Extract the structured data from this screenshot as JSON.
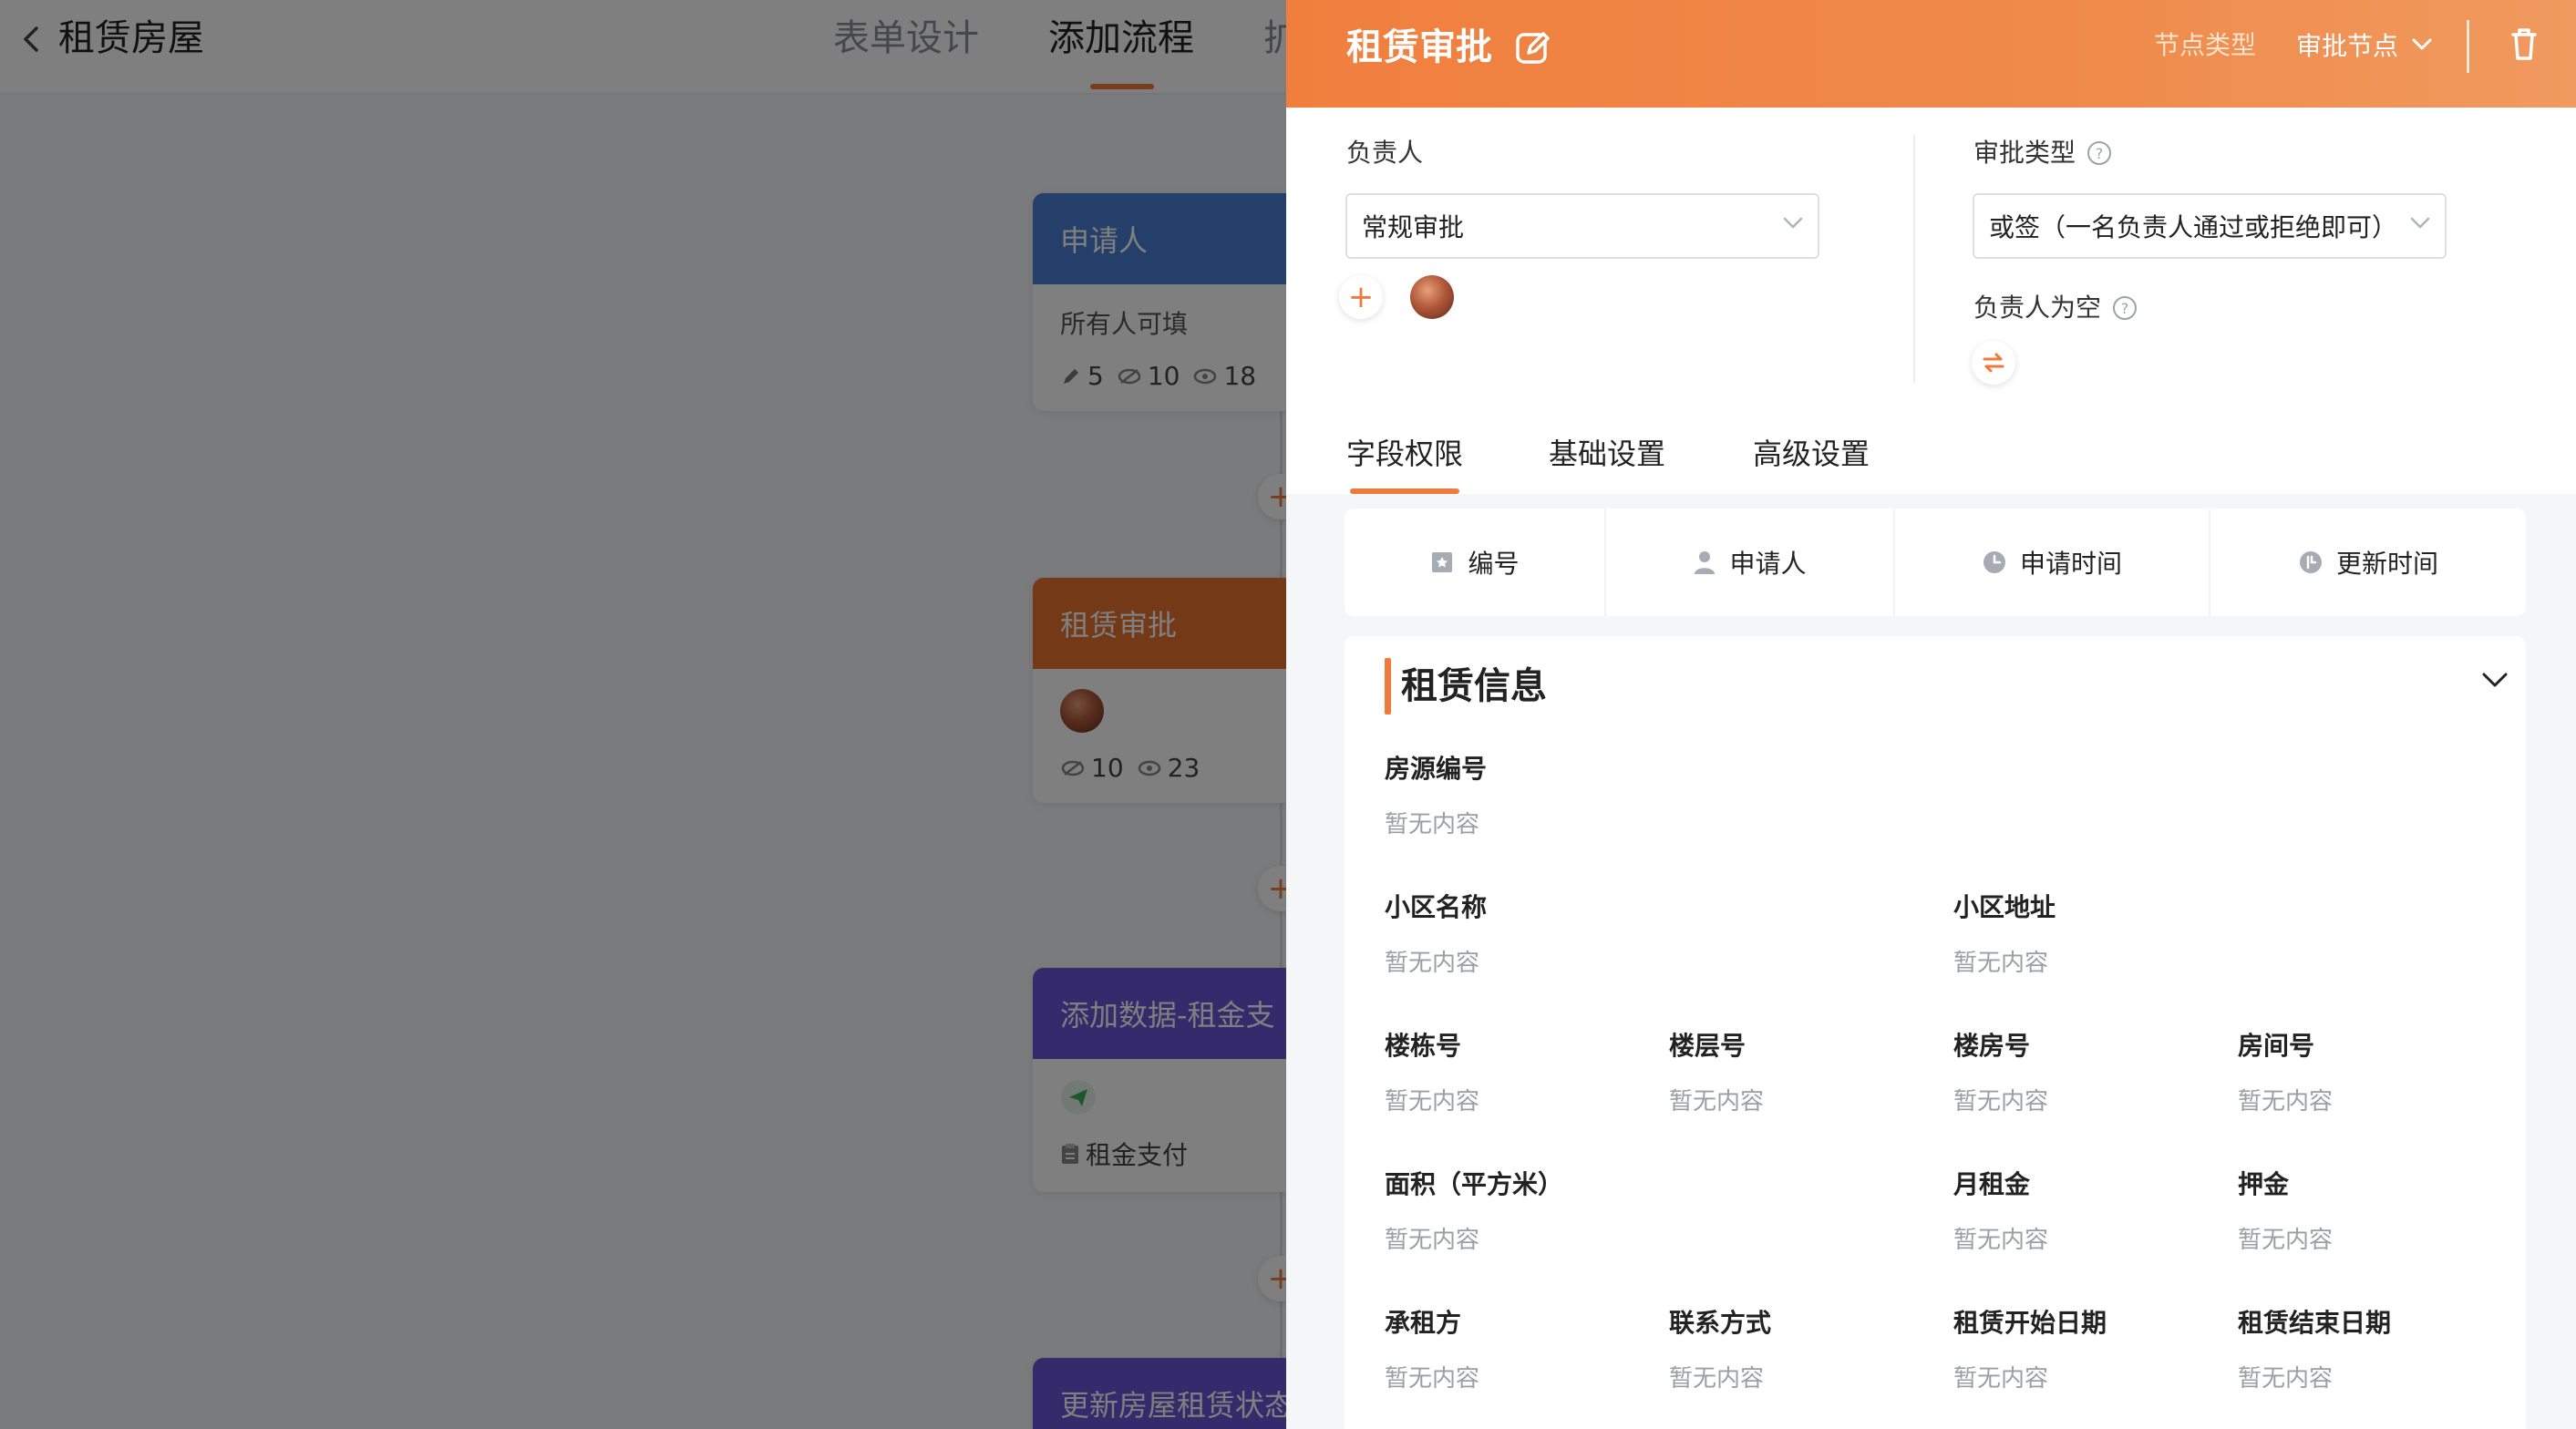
{
  "app": {
    "title": "租赁房屋",
    "nav_tabs": [
      {
        "label": "表单设计"
      },
      {
        "label": "添加流程"
      },
      {
        "label": "扩"
      }
    ]
  },
  "flow": {
    "nodes": [
      {
        "title": "申请人",
        "subtitle": "所有人可填",
        "stats": {
          "edit": "5",
          "hidden": "10",
          "view": "18"
        }
      },
      {
        "title": "租赁审批",
        "stats": {
          "hidden": "10",
          "view": "23"
        }
      },
      {
        "title": "添加数据-租金支",
        "target": "租金支付"
      },
      {
        "title": "更新房屋租赁状态"
      }
    ],
    "colors": {
      "applicant": "#4a7ed6",
      "approval": "#e9722f",
      "add_data": "#6a55d9",
      "update": "#6a55d9"
    }
  },
  "drawer": {
    "title": "租赁审批",
    "node_type_label": "节点类型",
    "node_type_value": "审批节点",
    "assignee_label": "负责人",
    "assignee_value": "常规审批",
    "approval_type_label": "审批类型",
    "approval_type_value": "或签（一名负责人通过或拒绝即可）",
    "empty_assignee_label": "负责人为空",
    "tabs": [
      {
        "label": "字段权限"
      },
      {
        "label": "基础设置"
      },
      {
        "label": "高级设置"
      }
    ],
    "system_fields": [
      {
        "label": "编号",
        "icon": "id-badge-icon"
      },
      {
        "label": "申请人",
        "icon": "person-icon"
      },
      {
        "label": "申请时间",
        "icon": "clock-icon"
      },
      {
        "label": "更新时间",
        "icon": "update-clock-icon"
      }
    ],
    "section": {
      "title": "租赁信息",
      "empty_text": "暂无内容",
      "fields": {
        "house_no": "房源编号",
        "community_name": "小区名称",
        "community_address": "小区地址",
        "building_no": "楼栋号",
        "floor_no": "楼层号",
        "unit_no": "楼房号",
        "room_no": "房间号",
        "area": "面积（平方米）",
        "monthly_rent": "月租金",
        "deposit": "押金",
        "tenant": "承租方",
        "contact": "联系方式",
        "lease_start": "租赁开始日期",
        "lease_end": "租赁结束日期"
      }
    },
    "accent_color": "#ee7a3c"
  }
}
